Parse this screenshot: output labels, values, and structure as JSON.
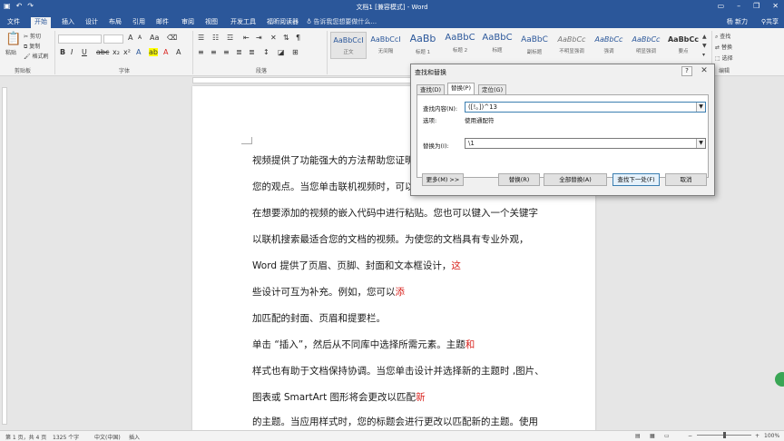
{
  "titlebar": {
    "title": "文档1 [兼容模式] - Word",
    "qat_icons": [
      "save-icon",
      "undo-icon",
      "redo-icon"
    ],
    "controls": [
      "minimize-icon",
      "restore-icon",
      "close-icon"
    ]
  },
  "tabs": {
    "items": [
      "文件",
      "开始",
      "插入",
      "设计",
      "布局",
      "引用",
      "邮件",
      "审阅",
      "视图",
      "开发工具",
      "福昕阅读器"
    ],
    "active": "开始",
    "tell_me": "告诉我您想要做什么...",
    "user": "杨 新力",
    "share": "共享"
  },
  "ribbon": {
    "clipboard": {
      "paste": "粘贴",
      "cut": "剪切",
      "copy": "复制",
      "format_painter": "格式刷",
      "label": "剪贴板"
    },
    "font": {
      "label": "字体",
      "bold": "B",
      "italic": "I",
      "underline": "U",
      "grow": "A",
      "shrink": "A"
    },
    "paragraph": {
      "label": "段落"
    },
    "styles": [
      {
        "sample": "AaBbCcI",
        "name": "正文"
      },
      {
        "sample": "AaBbCcI",
        "name": "无间隔"
      },
      {
        "sample": "AaBb",
        "name": "标题 1"
      },
      {
        "sample": "AaBbC",
        "name": "标题 2"
      },
      {
        "sample": "AaBbC",
        "name": "标题"
      },
      {
        "sample": "AaBbC",
        "name": "副标题"
      },
      {
        "sample": "AaBbCc",
        "name": "不明显强调"
      },
      {
        "sample": "AaBbCc",
        "name": "强调"
      },
      {
        "sample": "AaBbCc",
        "name": "明显强调"
      },
      {
        "sample": "AaBbCc",
        "name": "要点"
      }
    ],
    "editing": {
      "find": "查找",
      "replace": "替换",
      "select": "选择",
      "label": "编辑"
    }
  },
  "document": {
    "lines": [
      {
        "text": "视频提供了功能强大的方法帮助您证明",
        "red": ""
      },
      {
        "text": "您的观点。当您单击联机视频时，可以",
        "red": ""
      },
      {
        "text": "在想要添加的视频的嵌入代码中进行粘贴。您也可以键入一个关键字",
        "red": ""
      },
      {
        "text": "以联机搜索最适合您的文档的视频。为使您的文档具有专业外观，",
        "red": ""
      },
      {
        "text": "Word  提供了页眉、页脚、封面和文本框设计，",
        "red": "这"
      },
      {
        "text": "些设计可互为补充。例如，您可以",
        "red": "添"
      },
      {
        "text": "加匹配的封面、页眉和提要栏。",
        "red": ""
      },
      {
        "text": "单击 “插入”，然后从不同库中选择所需元素。主题",
        "red": "和"
      },
      {
        "text": "样式也有助于文档保持协调。当您单击设计并选择新的主题时 ,图片、",
        "red": ""
      },
      {
        "text": "图表或  SmartArt  图形将会更改以匹配",
        "red": "新"
      },
      {
        "text": "的主题。当应用样式时，您的标题会进行更改以匹配新的主题。使用",
        "red": ""
      }
    ]
  },
  "dialog": {
    "title": "查找和替换",
    "help": "?",
    "close": "✕",
    "tabs": [
      "查找(D)",
      "替换(P)",
      "定位(G)"
    ],
    "active_tab": "替换(P)",
    "find_label": "查找内容(N):",
    "find_value": "([!。])^13",
    "options_label": "选项:",
    "options_value": "使用通配符",
    "replace_label": "替换为(I):",
    "replace_value": "\\1",
    "buttons": {
      "more": "更多(M) >>",
      "replace": "替换(R)",
      "replace_all": "全部替换(A)",
      "find_next": "查找下一处(F)",
      "cancel": "取消"
    }
  },
  "status": {
    "page": "第 1 页，共 4 页",
    "words": "1325 个字",
    "language": "中文(中国)",
    "mode": "插入",
    "zoom": "100%"
  }
}
